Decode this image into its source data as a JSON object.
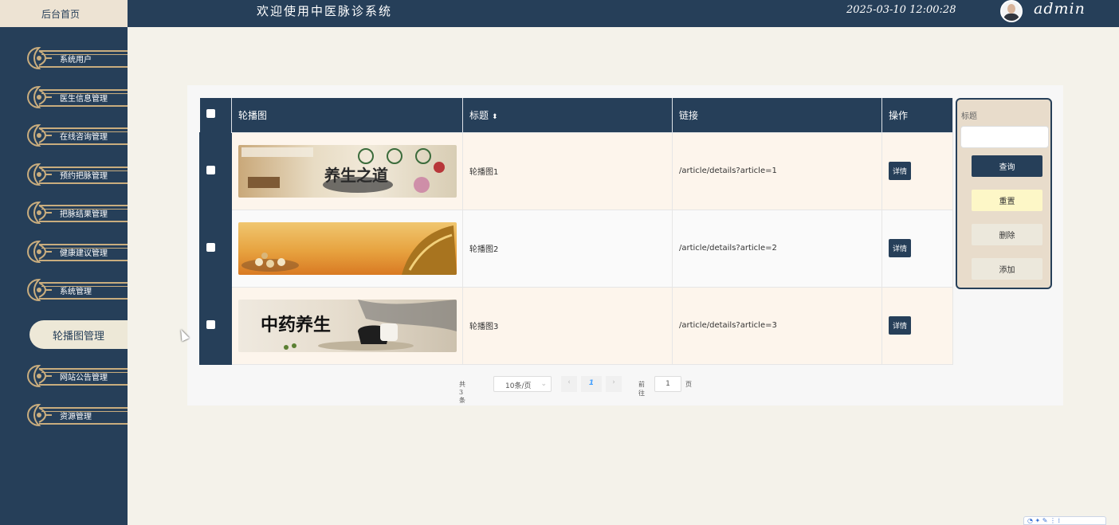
{
  "header": {
    "home_tab": "后台首页",
    "app_title": "欢迎使用中医脉诊系统",
    "datetime": "2025-03-10 12:00:28",
    "username": "admin"
  },
  "sidebar": {
    "items": [
      {
        "label": "系统用户"
      },
      {
        "label": "医生信息管理"
      },
      {
        "label": "在线咨询管理"
      },
      {
        "label": "预约把脉管理"
      },
      {
        "label": "把脉结果管理"
      },
      {
        "label": "健康建议管理"
      },
      {
        "label": "系统管理"
      },
      {
        "label": "网站公告管理"
      },
      {
        "label": "资源管理"
      }
    ],
    "active_label": "轮播图管理"
  },
  "table": {
    "headers": {
      "image": "轮播图",
      "title": "标题",
      "link": "链接",
      "action": "操作"
    },
    "rows": [
      {
        "banner_text": "养生之道",
        "title": "轮播图1",
        "link": "/article/details?article=1",
        "action": "详情"
      },
      {
        "banner_text": "",
        "title": "轮播图2",
        "link": "/article/details?article=2",
        "action": "详情"
      },
      {
        "banner_text": "中药养生",
        "title": "轮播图3",
        "link": "/article/details?article=3",
        "action": "详情"
      }
    ]
  },
  "search": {
    "label": "标题",
    "placeholder": "",
    "query_button": "查询",
    "reset_button": "重置",
    "delete_button": "删除",
    "add_button": "添加"
  },
  "pagination": {
    "total": "共 3 条",
    "page_size": "10条/页",
    "current_page": "1",
    "goto_label": "前往",
    "goto_value": "1",
    "page_suffix": "页"
  },
  "colors": {
    "primary": "#263f59",
    "accent_gold": "#c9ad7e",
    "row_highlight": "#fdf5ec",
    "content_bg": "#f4f2ea"
  }
}
